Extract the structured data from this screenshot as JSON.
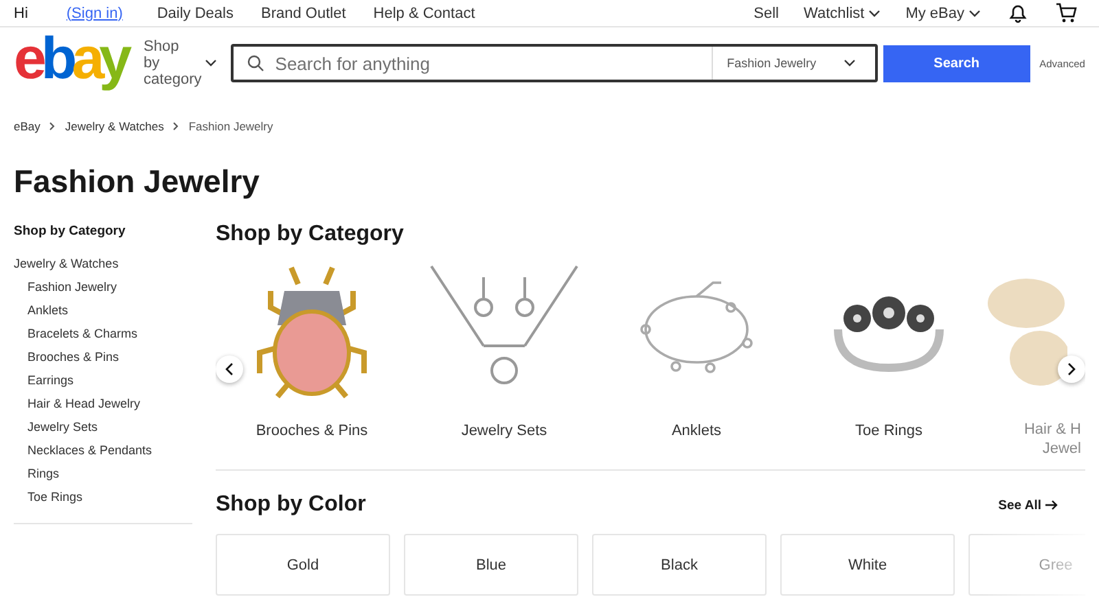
{
  "top_bar": {
    "greeting": "Hi",
    "sign_in": "(Sign in)",
    "links": [
      "Daily Deals",
      "Brand Outlet",
      "Help & Contact"
    ],
    "right_links": [
      {
        "label": "Sell",
        "dropdown": false
      },
      {
        "label": "Watchlist",
        "dropdown": true
      },
      {
        "label": "My eBay",
        "dropdown": true
      }
    ]
  },
  "header": {
    "logo": "ebay",
    "shop_by_category": "Shop by category",
    "search": {
      "placeholder": "Search for anything",
      "category": "Fashion Jewelry"
    },
    "search_button": "Search",
    "advanced": "Advanced"
  },
  "breadcrumb": [
    "eBay",
    "Jewelry & Watches",
    "Fashion Jewelry"
  ],
  "page_title": "Fashion Jewelry",
  "sidebar": {
    "title": "Shop by Category",
    "items": [
      {
        "label": "Jewelry & Watches",
        "children": [
          {
            "label": "Fashion Jewelry"
          },
          {
            "label": "Anklets"
          },
          {
            "label": "Bracelets & Charms"
          },
          {
            "label": "Brooches & Pins"
          },
          {
            "label": "Earrings"
          },
          {
            "label": "Hair & Head Jewelry"
          },
          {
            "label": "Jewelry Sets"
          },
          {
            "label": "Necklaces & Pendants"
          },
          {
            "label": "Rings"
          },
          {
            "label": "Toe Rings"
          }
        ]
      }
    ]
  },
  "category_section": {
    "title": "Shop by Category",
    "cards": [
      {
        "label": "Brooches & Pins"
      },
      {
        "label": "Jewelry Sets"
      },
      {
        "label": "Anklets"
      },
      {
        "label": "Toe Rings"
      },
      {
        "label": "Hair & H Jewel"
      }
    ]
  },
  "color_section": {
    "title": "Shop by Color",
    "see_all": "See All",
    "colors": [
      "Gold",
      "Blue",
      "Black",
      "White",
      "Gree"
    ]
  }
}
